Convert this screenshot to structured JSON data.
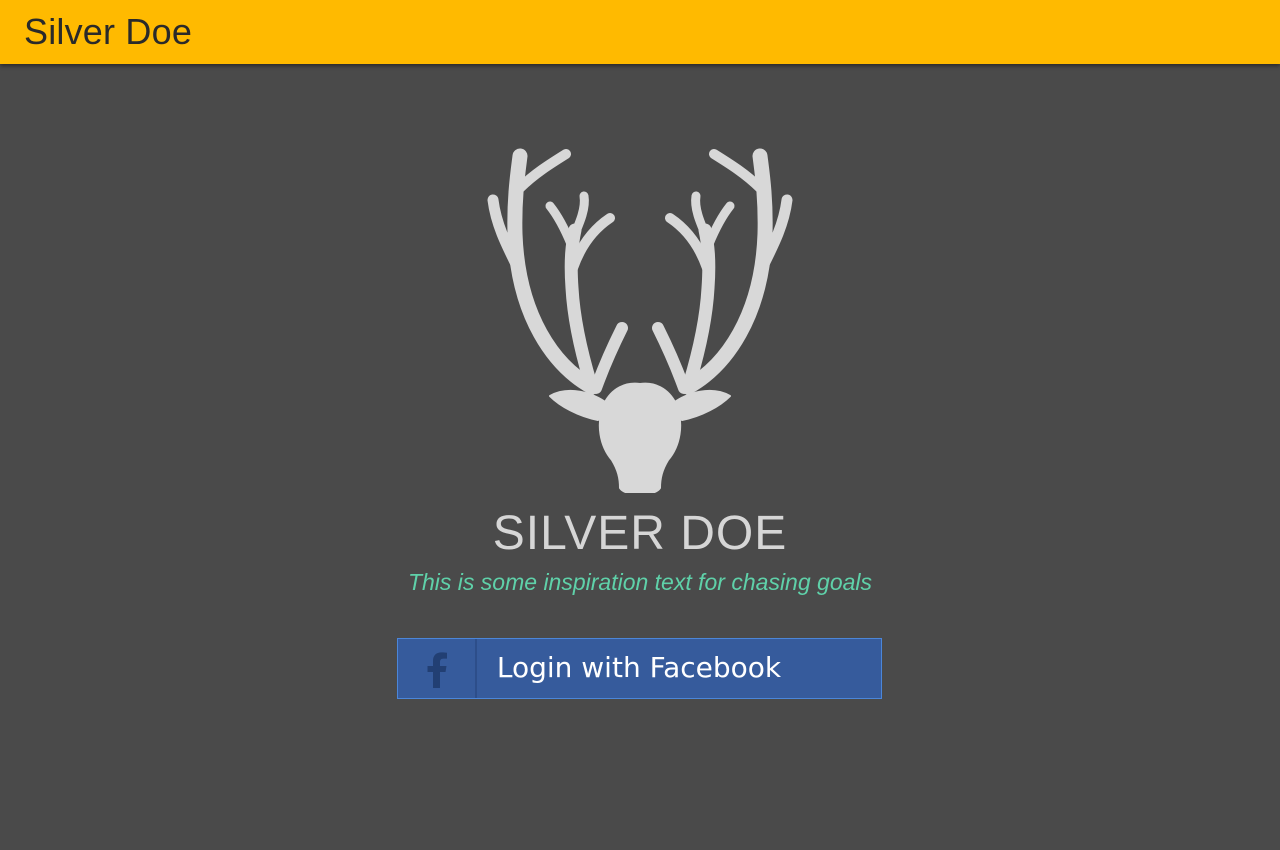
{
  "appbar": {
    "title": "Silver Doe"
  },
  "hero": {
    "logo_icon": "deer-antlers-icon",
    "brand_name": "SILVER DOE",
    "tagline": "This is some inspiration text for chasing goals"
  },
  "login": {
    "facebook_label": "Login with Facebook",
    "facebook_icon": "facebook-f-icon"
  },
  "colors": {
    "appbar_background": "#ffba00",
    "page_background": "#4a4a4a",
    "logo": "#d8d8d8",
    "tagline": "#5fd1a9",
    "facebook_button": "#365b9c"
  }
}
